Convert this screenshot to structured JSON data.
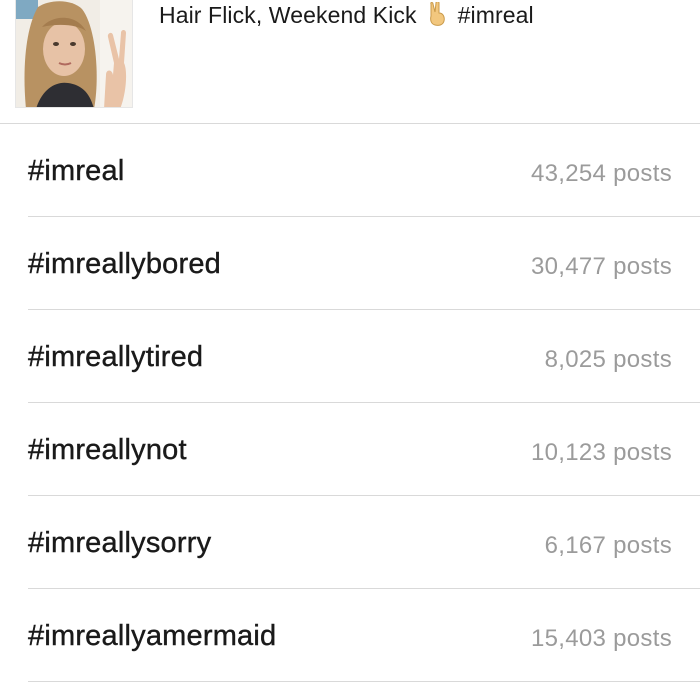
{
  "post": {
    "caption_before": "Hair Flick, Weekend Kick",
    "caption_emoji_icon": "victory-hand-icon",
    "caption_after": "#imreal",
    "thumbnail_icon": "selfie-photo"
  },
  "hashtags": [
    {
      "tag": "#imreal",
      "count": "43,254 posts"
    },
    {
      "tag": "#imreallybored",
      "count": "30,477 posts"
    },
    {
      "tag": "#imreallytired",
      "count": "8,025 posts"
    },
    {
      "tag": "#imreallynot",
      "count": "10,123 posts"
    },
    {
      "tag": "#imreallysorry",
      "count": "6,167 posts"
    },
    {
      "tag": "#imreallyamermaid",
      "count": "15,403 posts"
    }
  ],
  "colors": {
    "text": "#1a1a1a",
    "muted": "#9b9b9b",
    "divider": "#d9d9d9"
  }
}
